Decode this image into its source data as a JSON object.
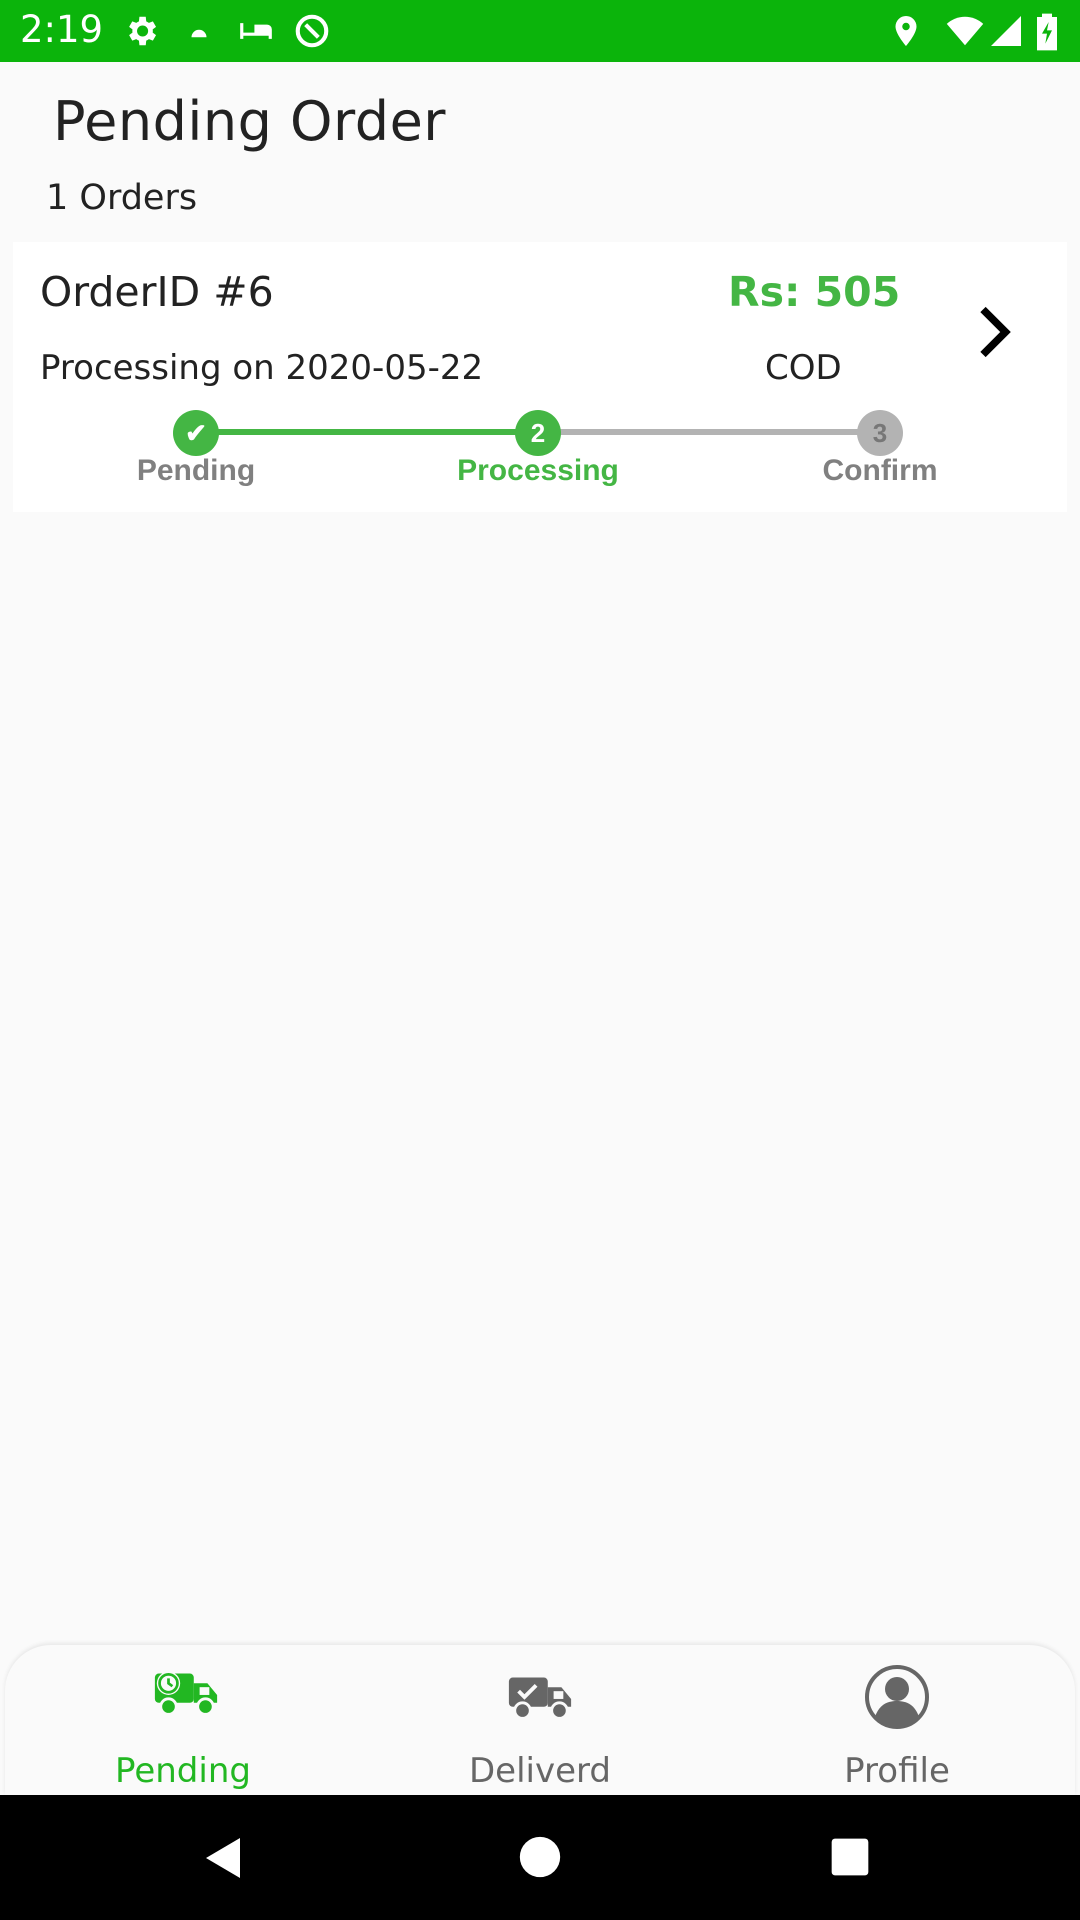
{
  "status_bar": {
    "time": "2:19"
  },
  "header": {
    "title": "Pending Order",
    "order_count": "1 Orders"
  },
  "orders": [
    {
      "id_label": "OrderID #6",
      "price_label": "Rs:  505",
      "date_label": "Processing on 2020-05-22",
      "payment_method": "COD",
      "steps": [
        {
          "label": "Pending",
          "marker": "✔",
          "state": "done"
        },
        {
          "label": "Processing",
          "marker": "2",
          "state": "current"
        },
        {
          "label": "Confirm",
          "marker": "3",
          "state": "upcoming"
        }
      ]
    }
  ],
  "bottom_nav": {
    "items": [
      {
        "label": "Pending",
        "icon": "truck-clock-icon",
        "active": true
      },
      {
        "label": "Deliverd",
        "icon": "truck-check-icon",
        "active": false
      },
      {
        "label": "Profile",
        "icon": "profile-icon",
        "active": false
      }
    ]
  },
  "colors": {
    "status_bar": "#0bb40b",
    "accent": "#44b644",
    "inactive": "#b3b3b3",
    "nav_active": "#22b722",
    "nav_inactive": "#666666"
  }
}
